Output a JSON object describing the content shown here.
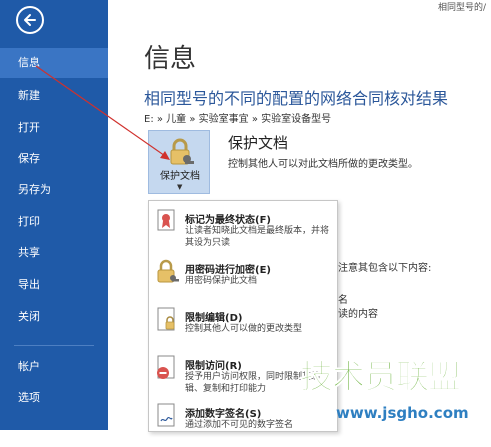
{
  "header": {
    "corner_text": "相同型号的/"
  },
  "sidebar": {
    "back_icon": "back-arrow-icon",
    "items": [
      {
        "label": "信息"
      },
      {
        "label": "新建"
      },
      {
        "label": "打开"
      },
      {
        "label": "保存"
      },
      {
        "label": "另存为"
      },
      {
        "label": "打印"
      },
      {
        "label": "共享"
      },
      {
        "label": "导出"
      },
      {
        "label": "关闭"
      },
      {
        "label": "帐户"
      },
      {
        "label": "选项"
      }
    ]
  },
  "main": {
    "page_title": "信息",
    "doc_title": "相同型号的不同的配置的网络合同核对结果",
    "breadcrumb": "E: » 儿童 » 实验室事宜 » 实验室设备型号",
    "protect": {
      "button_label": "保护文档",
      "title": "保护文档",
      "description": "控制其他人可以对此文档所做的更改类型。"
    },
    "background_fragments": {
      "f1": "注意其包含以下内容:",
      "f2": "名",
      "f3": "读的内容"
    }
  },
  "dropdown": {
    "items": [
      {
        "title": "标记为最终状态(F)",
        "desc": "让读者知晓此文档是最终版本，并将其设为只读",
        "icon": "ribbon-certificate-icon"
      },
      {
        "title": "用密码进行加密(E)",
        "desc": "用密码保护此文档",
        "icon": "lock-key-icon"
      },
      {
        "title": "限制编辑(D)",
        "desc": "控制其他人可以做的更改类型",
        "icon": "document-lock-icon"
      },
      {
        "title": "限制访问(R)",
        "desc": "授予用户访问权限，同时限制其编辑、复制和打印能力",
        "icon": "document-restricted-icon"
      },
      {
        "title": "添加数字签名(S)",
        "desc": "通过添加不可见的数字签名",
        "icon": "document-signature-icon"
      }
    ]
  },
  "watermark": {
    "main": "技术员联盟",
    "url": "www.jsgho.com"
  },
  "colors": {
    "sidebar": "#1f5aa8",
    "sidebar_active": "#3a75c4",
    "title_blue": "#2b579a",
    "button_bg": "#c5d8ef",
    "annotation_arrow": "#d0312d"
  }
}
